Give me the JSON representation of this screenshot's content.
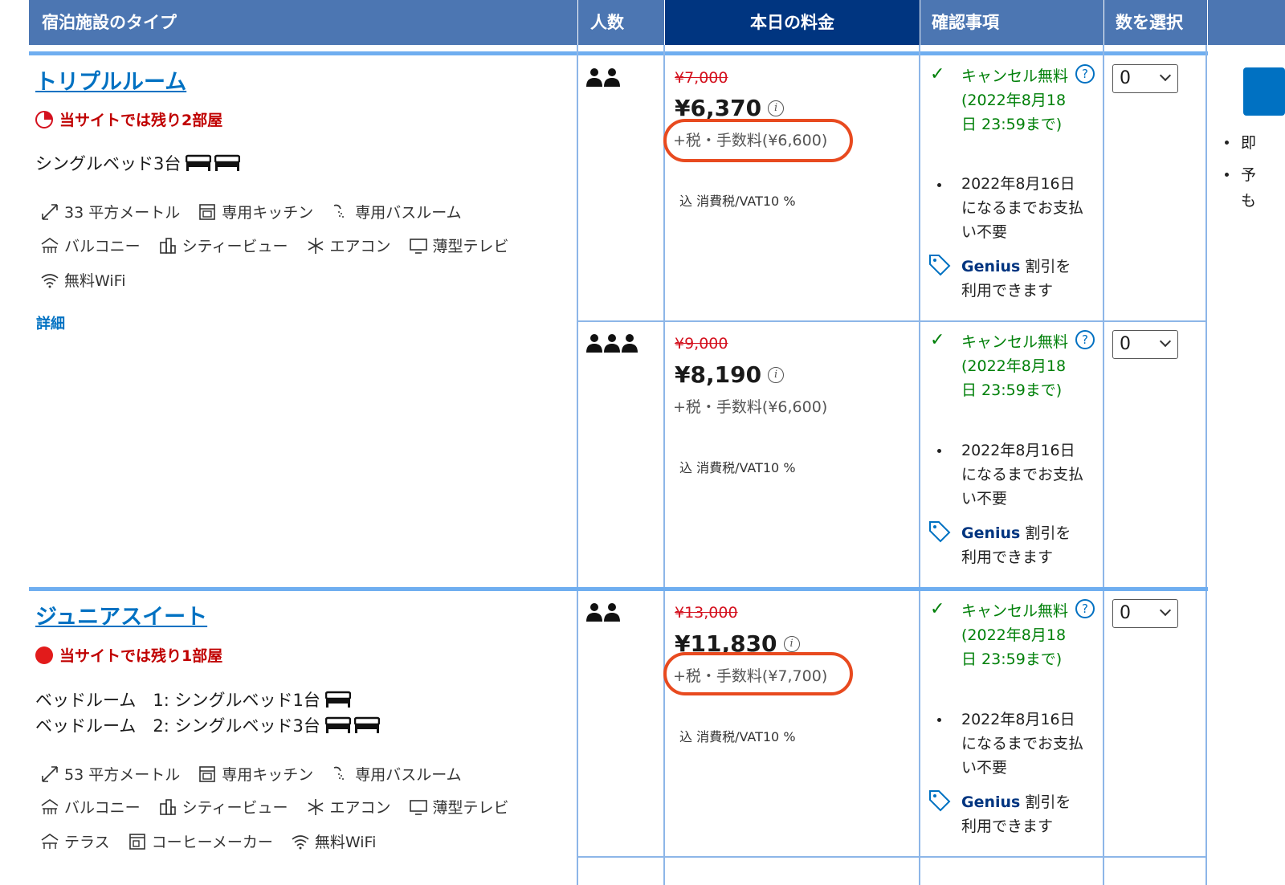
{
  "header": {
    "type": "宿泊施設のタイプ",
    "people": "人数",
    "price": "本日の料金",
    "conditions": "確認事項",
    "select": "数を選択"
  },
  "rooms": [
    {
      "title": "トリプルルーム",
      "scarcity": "当サイトでは残り2部屋",
      "beds": [
        "シングルベッド3台"
      ],
      "facilities_row1": [
        "33 平方メートル",
        "専用キッチン",
        "専用バスルーム"
      ],
      "facilities_row2": [
        "バルコニー",
        "シティービュー",
        "エアコン",
        "薄型テレビ"
      ],
      "facilities_row3": [
        "無料WiFi"
      ],
      "details": "詳細"
    },
    {
      "title": "ジュニアスイート",
      "scarcity": "当サイトでは残り1部屋",
      "beds": [
        "ベッドルーム　1: シングルベッド1台",
        "ベッドルーム　2: シングルベッド3台"
      ],
      "facilities_row1": [
        "53 平方メートル",
        "専用キッチン",
        "専用バスルーム"
      ],
      "facilities_row2": [
        "バルコニー",
        "シティービュー",
        "エアコン",
        "薄型テレビ"
      ],
      "facilities_row3": [
        "テラス",
        "コーヒーメーカー",
        "無料WiFi"
      ]
    }
  ],
  "offers": [
    {
      "people_count": 2,
      "old_price": "¥7,000",
      "price": "¥6,370",
      "tax": "+税・手数料(¥6,600)",
      "vat": "込 消費税/VAT10 %",
      "cancel": "キャンセル無料 (2022年8月18日 23:59まで)",
      "pay": "2022年8月16日になるまでお支払い不要",
      "genius_brand": "Genius",
      "genius_text": " 割引を利用できます",
      "select_value": "0"
    },
    {
      "people_count": 3,
      "old_price": "¥9,000",
      "price": "¥8,190",
      "tax": "+税・手数料(¥6,600)",
      "vat": "込 消費税/VAT10 %",
      "cancel": "キャンセル無料 (2022年8月18日 23:59まで)",
      "pay": "2022年8月16日になるまでお支払い不要",
      "genius_brand": "Genius",
      "genius_text": " 割引を利用できます",
      "select_value": "0"
    },
    {
      "people_count": 2,
      "old_price": "¥13,000",
      "price": "¥11,830",
      "tax": "+税・手数料(¥7,700)",
      "vat": "込 消費税/VAT10 %",
      "cancel": "キャンセル無料 (2022年8月18日 23:59まで)",
      "pay": "2022年8月16日になるまでお支払い不要",
      "genius_brand": "Genius",
      "genius_text": " 割引を利用できます",
      "select_value": "0"
    }
  ],
  "side": {
    "item1": "即",
    "item2": "予",
    "item2b": "も"
  },
  "colors": {
    "header_bg": "#4c76b2",
    "header_active": "#003580",
    "link": "#0071c2",
    "green": "#008009",
    "red": "#d4111e",
    "annotation": "#e84a1f"
  }
}
